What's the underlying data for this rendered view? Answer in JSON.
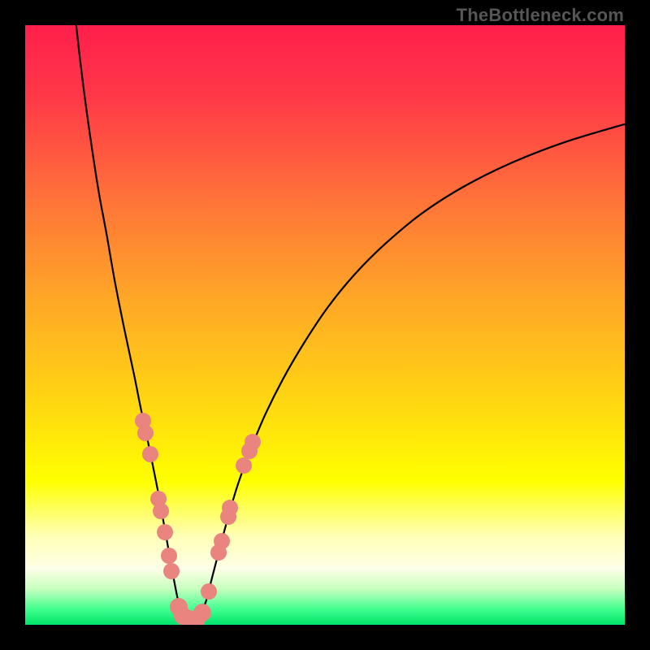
{
  "watermark": "TheBottleneck.com",
  "chart_data": {
    "type": "line",
    "title": "",
    "xlabel": "",
    "ylabel": "",
    "xlim": [
      0,
      100
    ],
    "ylim": [
      0,
      100
    ],
    "background_gradient": {
      "stops": [
        {
          "offset": 0.0,
          "color": "#ff1f4b"
        },
        {
          "offset": 0.12,
          "color": "#ff3848"
        },
        {
          "offset": 0.3,
          "color": "#ff7638"
        },
        {
          "offset": 0.46,
          "color": "#ffa826"
        },
        {
          "offset": 0.62,
          "color": "#ffd413"
        },
        {
          "offset": 0.76,
          "color": "#ffff00"
        },
        {
          "offset": 0.85,
          "color": "#ffffb3"
        },
        {
          "offset": 0.905,
          "color": "#ffffe8"
        },
        {
          "offset": 0.94,
          "color": "#c7ffbe"
        },
        {
          "offset": 0.975,
          "color": "#3eff8f"
        },
        {
          "offset": 1.0,
          "color": "#00e469"
        }
      ]
    },
    "curve_color": "#000000",
    "series": [
      {
        "name": "left-curve",
        "points": [
          {
            "x": 8.5,
            "y": 100.0
          },
          {
            "x": 9.3,
            "y": 93.0
          },
          {
            "x": 10.2,
            "y": 86.0
          },
          {
            "x": 11.2,
            "y": 79.0
          },
          {
            "x": 12.3,
            "y": 72.0
          },
          {
            "x": 13.6,
            "y": 65.0
          },
          {
            "x": 15.0,
            "y": 57.0
          },
          {
            "x": 16.6,
            "y": 49.0
          },
          {
            "x": 18.2,
            "y": 41.5
          },
          {
            "x": 19.3,
            "y": 36.0
          },
          {
            "x": 20.8,
            "y": 29.0
          },
          {
            "x": 22.2,
            "y": 22.0
          },
          {
            "x": 23.1,
            "y": 17.0
          },
          {
            "x": 24.0,
            "y": 12.0
          },
          {
            "x": 25.0,
            "y": 6.5
          },
          {
            "x": 25.8,
            "y": 3.0
          },
          {
            "x": 27.0,
            "y": 1.0
          },
          {
            "x": 28.5,
            "y": 1.0
          }
        ]
      },
      {
        "name": "right-curve",
        "points": [
          {
            "x": 28.5,
            "y": 1.0
          },
          {
            "x": 30.0,
            "y": 3.5
          },
          {
            "x": 31.2,
            "y": 8.0
          },
          {
            "x": 32.5,
            "y": 13.0
          },
          {
            "x": 34.0,
            "y": 18.5
          },
          {
            "x": 35.5,
            "y": 23.5
          },
          {
            "x": 37.5,
            "y": 29.0
          },
          {
            "x": 40.0,
            "y": 35.0
          },
          {
            "x": 43.0,
            "y": 41.0
          },
          {
            "x": 46.5,
            "y": 47.0
          },
          {
            "x": 50.5,
            "y": 53.0
          },
          {
            "x": 55.0,
            "y": 58.5
          },
          {
            "x": 60.0,
            "y": 63.5
          },
          {
            "x": 66.0,
            "y": 68.5
          },
          {
            "x": 73.0,
            "y": 73.0
          },
          {
            "x": 81.0,
            "y": 77.0
          },
          {
            "x": 90.0,
            "y": 80.5
          },
          {
            "x": 100.0,
            "y": 83.5
          }
        ]
      }
    ],
    "markers": {
      "color": "#e9847f",
      "points": [
        {
          "x": 19.6,
          "y": 34.0,
          "r": 10
        },
        {
          "x": 20.0,
          "y": 32.0,
          "r": 10
        },
        {
          "x": 20.8,
          "y": 28.5,
          "r": 10
        },
        {
          "x": 22.2,
          "y": 21.0,
          "r": 10
        },
        {
          "x": 22.6,
          "y": 19.0,
          "r": 10
        },
        {
          "x": 23.3,
          "y": 15.5,
          "r": 10
        },
        {
          "x": 24.0,
          "y": 11.5,
          "r": 10
        },
        {
          "x": 24.4,
          "y": 9.0,
          "r": 10
        },
        {
          "x": 25.6,
          "y": 3.0,
          "r": 11
        },
        {
          "x": 26.3,
          "y": 1.5,
          "r": 11
        },
        {
          "x": 27.4,
          "y": 1.0,
          "r": 11
        },
        {
          "x": 28.6,
          "y": 1.0,
          "r": 11
        },
        {
          "x": 29.6,
          "y": 2.0,
          "r": 11
        },
        {
          "x": 30.6,
          "y": 5.5,
          "r": 10
        },
        {
          "x": 32.3,
          "y": 12.0,
          "r": 10
        },
        {
          "x": 32.8,
          "y": 14.0,
          "r": 10
        },
        {
          "x": 33.9,
          "y": 18.0,
          "r": 10
        },
        {
          "x": 34.2,
          "y": 19.5,
          "r": 10
        },
        {
          "x": 36.4,
          "y": 26.5,
          "r": 10
        },
        {
          "x": 37.4,
          "y": 29.0,
          "r": 10
        },
        {
          "x": 37.9,
          "y": 30.5,
          "r": 10
        }
      ]
    }
  }
}
